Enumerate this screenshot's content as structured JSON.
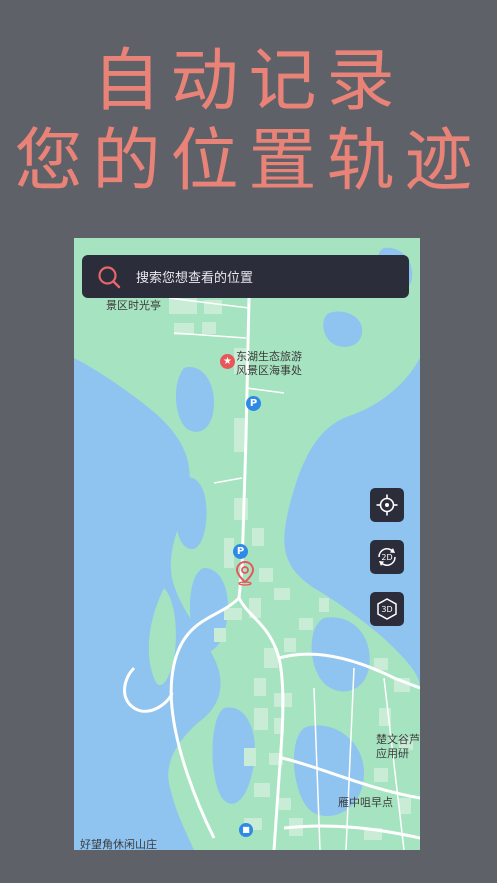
{
  "promo": {
    "line1": "自动记录",
    "line2": "您的位置轨迹",
    "text_color": "#ea8377",
    "background": "#5f6169"
  },
  "search": {
    "placeholder": "搜索您想查看的位置",
    "icon": "search-icon"
  },
  "map_controls": {
    "locate": {
      "icon": "crosshair-icon"
    },
    "view_2d": {
      "label": "2D",
      "icon": "rotate-2d-icon"
    },
    "view_3d": {
      "label": "3D",
      "icon": "cube-3d-icon"
    }
  },
  "map_labels": {
    "scenic_time_pavilion": "景区时光亭",
    "maritime_office_line1": "东湖生态旅游",
    "maritime_office_line2": "风景区海事处",
    "chuwen_line1": "楚文谷芦",
    "chuwen_line2": "应用研",
    "yanzhong": "雁中咀早点",
    "haowang": "好望角休闲山庄"
  },
  "map_colors": {
    "water": "#8fc3f0",
    "land": "#a6e3c0",
    "building": "#c8ecd6",
    "road": "#ffffff",
    "control_bg": "#2b2d3b"
  }
}
